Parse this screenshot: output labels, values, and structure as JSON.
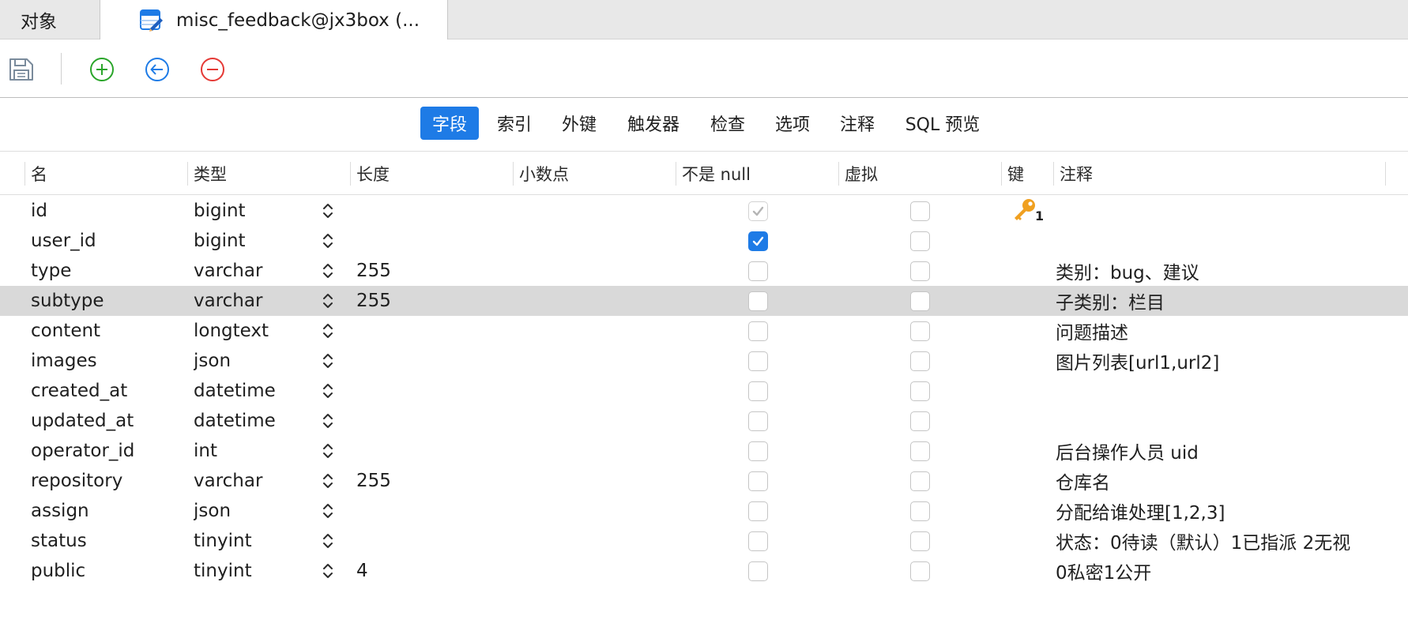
{
  "tabs": {
    "objects": "对象",
    "table": "misc_feedback@jx3box (..."
  },
  "toolbar": {
    "save": "save-icon",
    "add": "plus-circle-icon",
    "insert": "arrow-left-circle-icon",
    "delete": "minus-circle-icon"
  },
  "subtabs": [
    {
      "label": "字段",
      "active": true
    },
    {
      "label": "索引",
      "active": false
    },
    {
      "label": "外键",
      "active": false
    },
    {
      "label": "触发器",
      "active": false
    },
    {
      "label": "检查",
      "active": false
    },
    {
      "label": "选项",
      "active": false
    },
    {
      "label": "注释",
      "active": false
    },
    {
      "label": "SQL 预览",
      "active": false
    }
  ],
  "columns": {
    "name": "名",
    "type": "类型",
    "length": "长度",
    "decimal": "小数点",
    "notnull": "不是 null",
    "virtual": "虚拟",
    "key": "键",
    "comment": "注释"
  },
  "fields": [
    {
      "name": "id",
      "type": "bigint",
      "length": "",
      "decimal": "",
      "notnull": true,
      "notnull_disabled": true,
      "virtual": false,
      "key": "1",
      "comment": ""
    },
    {
      "name": "user_id",
      "type": "bigint",
      "length": "",
      "decimal": "",
      "notnull": true,
      "notnull_disabled": false,
      "virtual": false,
      "key": "",
      "comment": ""
    },
    {
      "name": "type",
      "type": "varchar",
      "length": "255",
      "decimal": "",
      "notnull": false,
      "notnull_disabled": false,
      "virtual": false,
      "key": "",
      "comment": "类别：bug、建议"
    },
    {
      "name": "subtype",
      "type": "varchar",
      "length": "255",
      "decimal": "",
      "notnull": false,
      "notnull_disabled": false,
      "virtual": false,
      "key": "",
      "comment": "子类别：栏目",
      "selected": true
    },
    {
      "name": "content",
      "type": "longtext",
      "length": "",
      "decimal": "",
      "notnull": false,
      "notnull_disabled": false,
      "virtual": false,
      "key": "",
      "comment": "问题描述"
    },
    {
      "name": "images",
      "type": "json",
      "length": "",
      "decimal": "",
      "notnull": false,
      "notnull_disabled": false,
      "virtual": false,
      "key": "",
      "comment": "图片列表[url1,url2]"
    },
    {
      "name": "created_at",
      "type": "datetime",
      "length": "",
      "decimal": "",
      "notnull": false,
      "notnull_disabled": false,
      "virtual": false,
      "key": "",
      "comment": ""
    },
    {
      "name": "updated_at",
      "type": "datetime",
      "length": "",
      "decimal": "",
      "notnull": false,
      "notnull_disabled": false,
      "virtual": false,
      "key": "",
      "comment": ""
    },
    {
      "name": "operator_id",
      "type": "int",
      "length": "",
      "decimal": "",
      "notnull": false,
      "notnull_disabled": false,
      "virtual": false,
      "key": "",
      "comment": "后台操作人员 uid"
    },
    {
      "name": "repository",
      "type": "varchar",
      "length": "255",
      "decimal": "",
      "notnull": false,
      "notnull_disabled": false,
      "virtual": false,
      "key": "",
      "comment": "仓库名"
    },
    {
      "name": "assign",
      "type": "json",
      "length": "",
      "decimal": "",
      "notnull": false,
      "notnull_disabled": false,
      "virtual": false,
      "key": "",
      "comment": "分配给谁处理[1,2,3]"
    },
    {
      "name": "status",
      "type": "tinyint",
      "length": "",
      "decimal": "",
      "notnull": false,
      "notnull_disabled": false,
      "virtual": false,
      "key": "",
      "comment": "状态：0待读（默认）1已指派 2无视"
    },
    {
      "name": "public",
      "type": "tinyint",
      "length": "4",
      "decimal": "",
      "notnull": false,
      "notnull_disabled": false,
      "virtual": false,
      "key": "",
      "comment": "0私密1公开"
    }
  ],
  "colors": {
    "accent": "#1e7be6",
    "add": "#2aa52a",
    "insert": "#1e7be6",
    "delete": "#e53935",
    "key": "#f0a020",
    "selected_row": "#d9d9d9"
  }
}
